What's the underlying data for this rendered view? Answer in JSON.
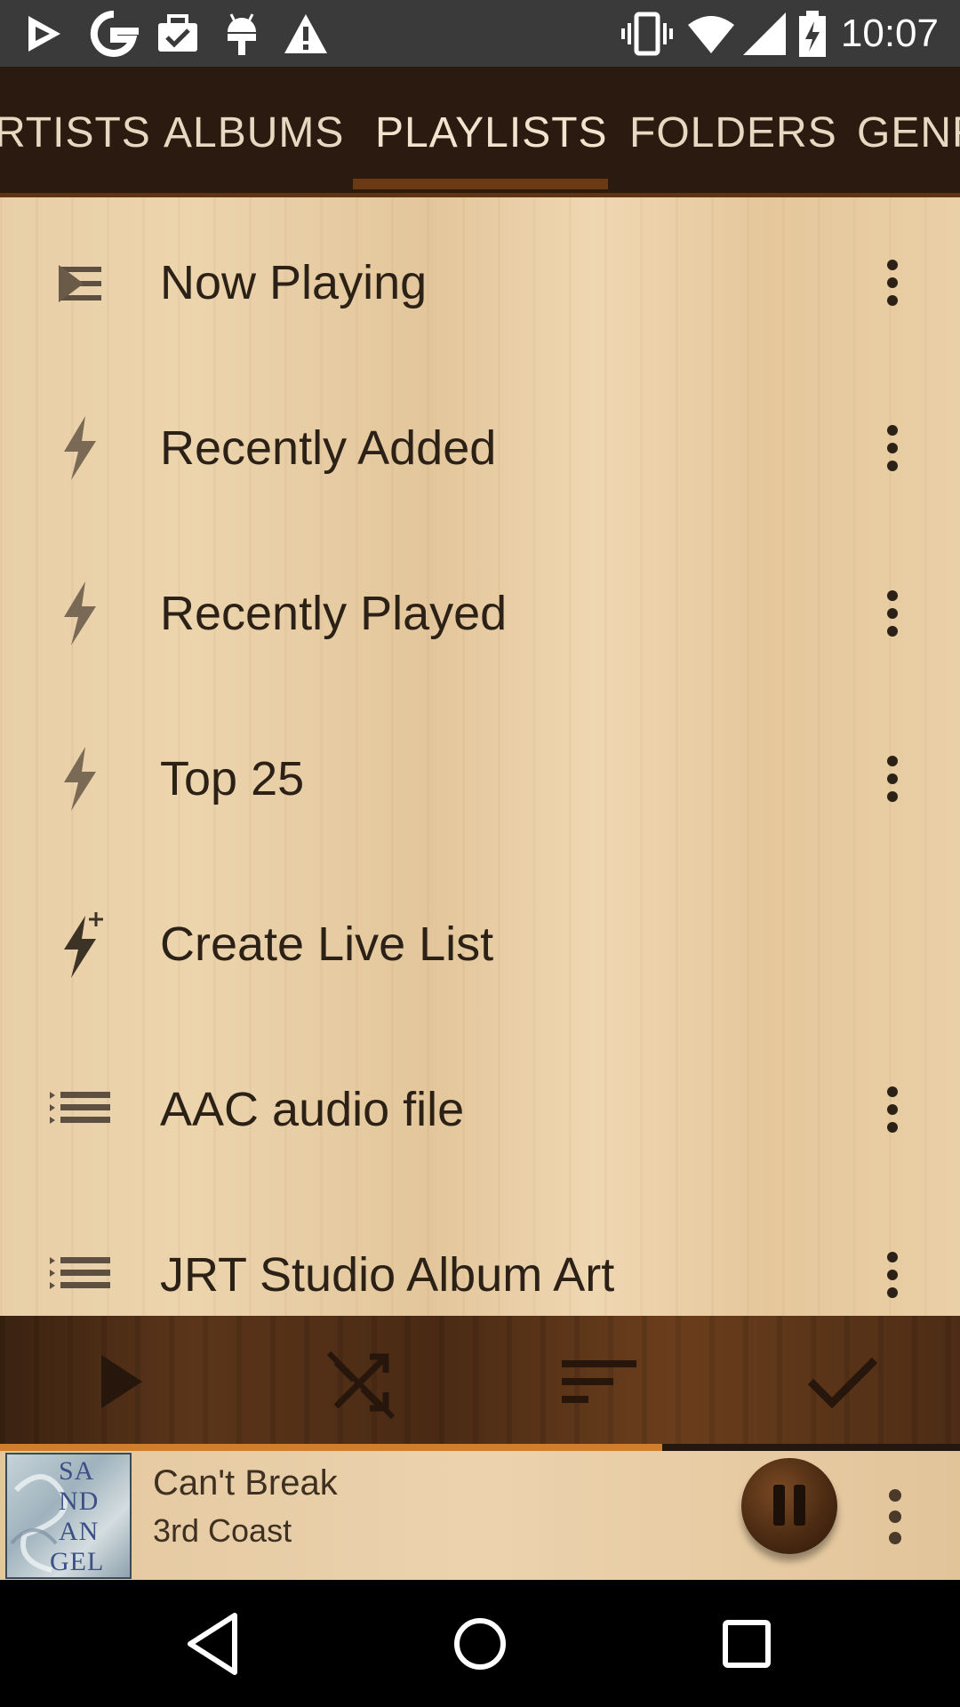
{
  "status_bar": {
    "time": "10:07",
    "left_icons": [
      "play-store-icon",
      "google-icon",
      "briefcase-icon",
      "android-icon",
      "warning-icon"
    ],
    "right_icons": [
      "vibrate-icon",
      "wifi-icon",
      "signal-icon",
      "battery-charging-icon"
    ]
  },
  "tabs": {
    "items": [
      {
        "label": "RTISTS"
      },
      {
        "label": "ALBUMS"
      },
      {
        "label": "PLAYLISTS",
        "active": true
      },
      {
        "label": "FOLDERS"
      },
      {
        "label": "GENR"
      }
    ]
  },
  "playlists": {
    "items": [
      {
        "label": "Now Playing",
        "icon": "now-playing-list-icon"
      },
      {
        "label": "Recently Added",
        "icon": "lightning-icon"
      },
      {
        "label": "Recently Played",
        "icon": "lightning-icon"
      },
      {
        "label": "Top 25",
        "icon": "lightning-icon"
      },
      {
        "label": "Create Live List",
        "icon": "lightning-plus-icon"
      },
      {
        "label": "AAC audio file",
        "icon": "list-icon"
      },
      {
        "label": "JRT Studio Album Art",
        "icon": "list-icon"
      }
    ]
  },
  "action_bar": {
    "actions": [
      "play-icon",
      "shuffle-off-icon",
      "sort-icon",
      "check-icon"
    ]
  },
  "player": {
    "title": "Can't Break",
    "artist": "3rd Coast",
    "progress": 0.69,
    "album_art_text": [
      "SA",
      "ND",
      "AN",
      "GEL"
    ]
  },
  "nav_bar": {
    "buttons": [
      "back-icon",
      "home-icon",
      "recents-icon"
    ]
  },
  "colors": {
    "accent": "#d07e2b",
    "tab_bar": "#2b1a0f",
    "text_dark": "#2c2116"
  }
}
